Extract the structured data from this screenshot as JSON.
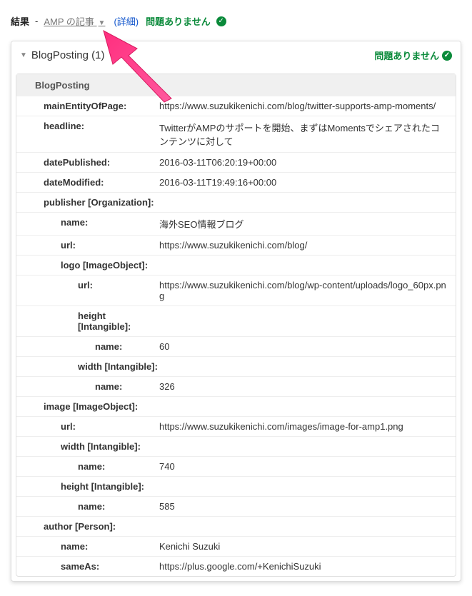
{
  "header": {
    "results_label": "結果",
    "separator": " - ",
    "amp_link": "AMP の記事",
    "detail_link": "(詳細)",
    "status_text": "問題ありません"
  },
  "panel": {
    "title": "BlogPosting (1)",
    "status_text": "問題ありません",
    "type_label": "BlogPosting"
  },
  "properties": {
    "mainEntityOfPage": {
      "key": "mainEntityOfPage:",
      "val": "https://www.suzukikenichi.com/blog/twitter-supports-amp-moments/"
    },
    "headline": {
      "key": "headline:",
      "val": "TwitterがAMPのサポートを開始、まずはMomentsでシェアされたコンテンツに対して"
    },
    "datePublished": {
      "key": "datePublished:",
      "val": "2016-03-11T06:20:19+00:00"
    },
    "dateModified": {
      "key": "dateModified:",
      "val": "2016-03-11T19:49:16+00:00"
    },
    "publisher": {
      "key": "publisher [Organization]:"
    },
    "publisher_name": {
      "key": "name:",
      "val": "海外SEO情報ブログ"
    },
    "publisher_url": {
      "key": "url:",
      "val": "https://www.suzukikenichi.com/blog/"
    },
    "publisher_logo": {
      "key": "logo [ImageObject]:"
    },
    "publisher_logo_url": {
      "key": "url:",
      "val": "https://www.suzukikenichi.com/blog/wp-content/uploads/logo_60px.png"
    },
    "publisher_logo_height": {
      "key": "height [Intangible]:"
    },
    "publisher_logo_height_name": {
      "key": "name:",
      "val": "60"
    },
    "publisher_logo_width": {
      "key": "width [Intangible]:"
    },
    "publisher_logo_width_name": {
      "key": "name:",
      "val": "326"
    },
    "image": {
      "key": "image [ImageObject]:"
    },
    "image_url": {
      "key": "url:",
      "val": "https://www.suzukikenichi.com/images/image-for-amp1.png"
    },
    "image_width": {
      "key": "width [Intangible]:"
    },
    "image_width_name": {
      "key": "name:",
      "val": "740"
    },
    "image_height": {
      "key": "height [Intangible]:"
    },
    "image_height_name": {
      "key": "name:",
      "val": "585"
    },
    "author": {
      "key": "author [Person]:"
    },
    "author_name": {
      "key": "name:",
      "val": "Kenichi Suzuki"
    },
    "author_sameAs": {
      "key": "sameAs:",
      "val": "https://plus.google.com/+KenichiSuzuki"
    }
  }
}
